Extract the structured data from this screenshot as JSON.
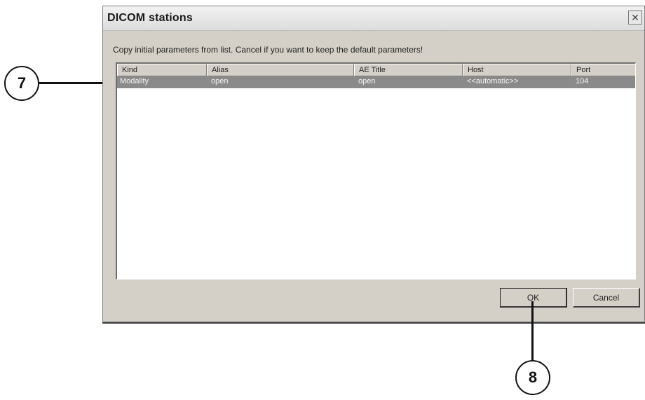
{
  "dialog": {
    "title": "DICOM stations",
    "close_glyph": "✕",
    "instruction": "Copy initial parameters from list. Cancel if you want to keep the default parameters!",
    "columns": [
      "Kind",
      "Alias",
      "AE Title",
      "Host",
      "Port"
    ],
    "rows": [
      {
        "kind": "Modality",
        "alias": "open",
        "ae_title": "open",
        "host": "<<automatic>>",
        "port": "104"
      }
    ],
    "buttons": {
      "ok": "OK",
      "cancel": "Cancel"
    }
  },
  "callouts": {
    "row_callout": "7",
    "ok_callout": "8"
  },
  "colors": {
    "dialog_bg": "#d4d0c8",
    "selected_row": "#8a8a8a"
  }
}
